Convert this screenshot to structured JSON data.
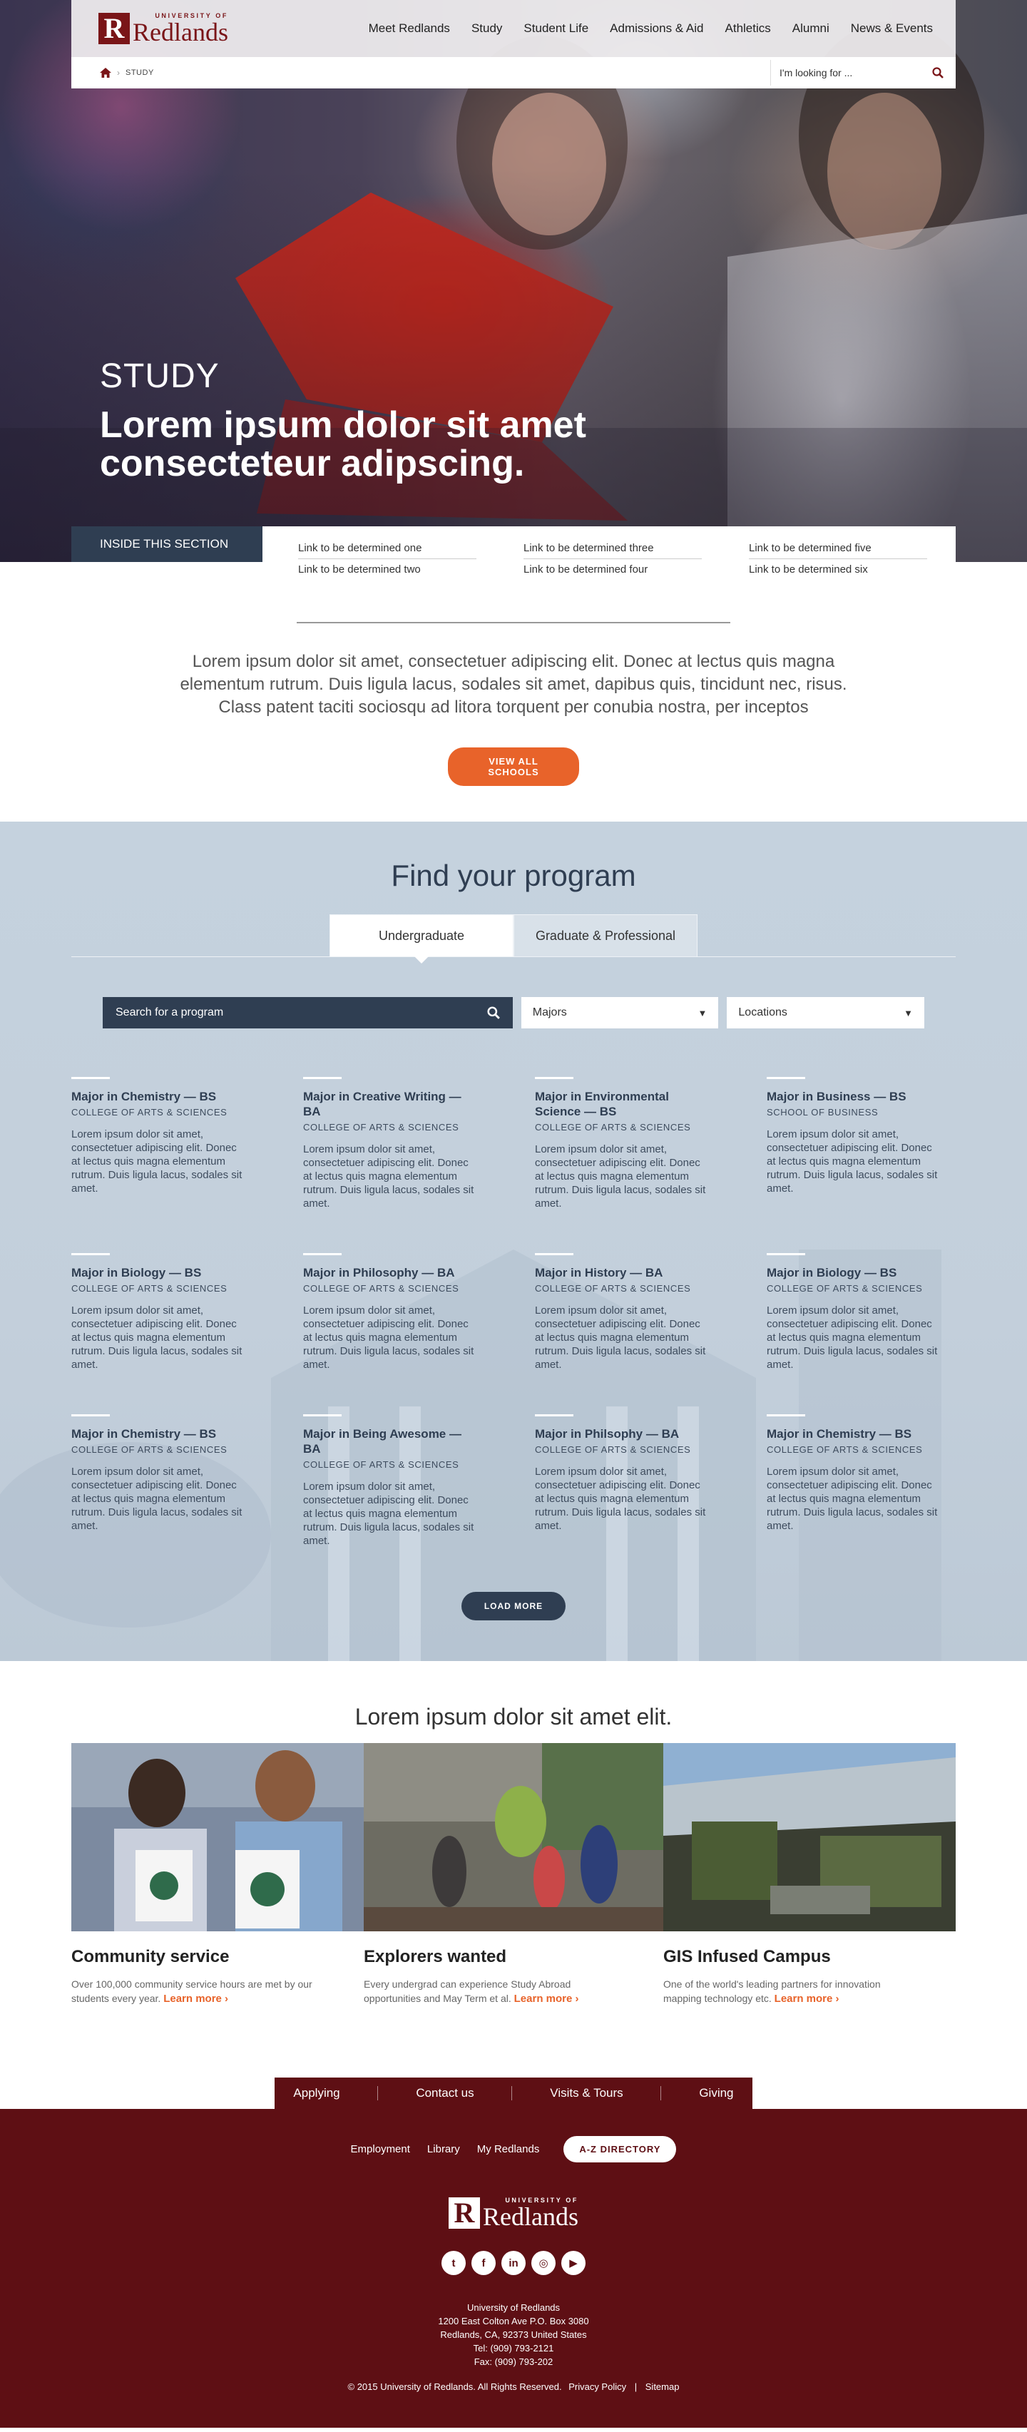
{
  "header": {
    "logo_small": "UNIVERSITY OF",
    "logo_big": "Redlands",
    "logo_mark": "R",
    "nav": [
      "Meet Redlands",
      "Study",
      "Student Life",
      "Admissions & Aid",
      "Athletics",
      "Alumni",
      "News & Events"
    ]
  },
  "breadcrumb": {
    "current": "STUDY",
    "home_icon": "home-icon",
    "separator": "›"
  },
  "search": {
    "placeholder": "I'm looking for ...",
    "icon": "search-icon"
  },
  "hero": {
    "eyebrow": "STUDY",
    "headline": "Lorem ipsum dolor sit amet consecteteur adipscing."
  },
  "inside_section": {
    "label": "INSIDE THIS SECTION",
    "links": [
      "Link to be determined one",
      "Link to be determined three",
      "Link to be determined five",
      "Link to be determined two",
      "Link to be determined four",
      "Link to be determined six"
    ]
  },
  "intro": {
    "text": "Lorem ipsum dolor sit amet, consectetuer adipiscing elit. Donec at lectus quis magna elementum rutrum. Duis ligula lacus, sodales sit amet, dapibus quis, tincidunt nec, risus. Class patent taciti sociosqu ad litora torquent per conubia nostra, per inceptos",
    "button": "VIEW ALL SCHOOLS"
  },
  "program_finder": {
    "title": "Find your program",
    "tabs": [
      "Undergraduate",
      "Graduate & Professional"
    ],
    "search_placeholder": "Search for a program",
    "majors_select": "Majors",
    "locations_select": "Locations",
    "load_more": "LOAD MORE",
    "programs": [
      {
        "title": "Major in Chemistry — BS",
        "school": "COLLEGE OF ARTS & SCIENCES",
        "desc": "Lorem ipsum dolor sit amet, consectetuer adipiscing elit. Donec at lectus quis magna elementum rutrum. Duis ligula lacus, sodales sit amet."
      },
      {
        "title": "Major in Creative Writing — BA",
        "school": "COLLEGE OF ARTS & SCIENCES",
        "desc": "Lorem ipsum dolor sit amet, consectetuer adipiscing elit. Donec at lectus quis magna elementum rutrum. Duis ligula lacus, sodales sit amet."
      },
      {
        "title": "Major in Environmental Science — BS",
        "school": "COLLEGE OF ARTS & SCIENCES",
        "desc": "Lorem ipsum dolor sit amet, consectetuer adipiscing elit. Donec at lectus quis magna elementum rutrum. Duis ligula lacus, sodales sit amet."
      },
      {
        "title": "Major in Business — BS",
        "school": "SCHOOL OF BUSINESS",
        "desc": "Lorem ipsum dolor sit amet, consectetuer adipiscing elit. Donec at lectus quis magna elementum rutrum. Duis ligula lacus, sodales sit amet."
      },
      {
        "title": "Major in Biology — BS",
        "school": "COLLEGE OF ARTS & SCIENCES",
        "desc": "Lorem ipsum dolor sit amet, consectetuer adipiscing elit. Donec at lectus quis magna elementum rutrum. Duis ligula lacus, sodales sit amet."
      },
      {
        "title": "Major in Philosophy — BA",
        "school": "COLLEGE OF ARTS & SCIENCES",
        "desc": "Lorem ipsum dolor sit amet, consectetuer adipiscing elit. Donec at lectus quis magna elementum rutrum. Duis ligula lacus, sodales sit amet."
      },
      {
        "title": "Major in History — BA",
        "school": "COLLEGE OF ARTS & SCIENCES",
        "desc": "Lorem ipsum dolor sit amet, consectetuer adipiscing elit. Donec at lectus quis magna elementum rutrum. Duis ligula lacus, sodales sit amet."
      },
      {
        "title": "Major in Biology — BS",
        "school": "COLLEGE OF ARTS & SCIENCES",
        "desc": "Lorem ipsum dolor sit amet, consectetuer adipiscing elit. Donec at lectus quis magna elementum rutrum. Duis ligula lacus, sodales sit amet."
      },
      {
        "title": "Major in Chemistry — BS",
        "school": "COLLEGE OF ARTS & SCIENCES",
        "desc": "Lorem ipsum dolor sit amet, consectetuer adipiscing elit. Donec at lectus quis magna elementum rutrum. Duis ligula lacus, sodales sit amet."
      },
      {
        "title": "Major in Being Awesome — BA",
        "school": "COLLEGE OF ARTS & SCIENCES",
        "desc": "Lorem ipsum dolor sit amet, consectetuer adipiscing elit. Donec at lectus quis magna elementum rutrum. Duis ligula lacus, sodales sit amet."
      },
      {
        "title": "Major in Philsophy — BA",
        "school": "COLLEGE OF ARTS & SCIENCES",
        "desc": "Lorem ipsum dolor sit amet, consectetuer adipiscing elit. Donec at lectus quis magna elementum rutrum. Duis ligula lacus, sodales sit amet."
      },
      {
        "title": "Major in Chemistry — BS",
        "school": "COLLEGE OF ARTS & SCIENCES",
        "desc": "Lorem ipsum dolor sit amet, consectetuer adipiscing elit. Donec at lectus quis magna elementum rutrum. Duis ligula lacus, sodales sit amet."
      }
    ]
  },
  "features": {
    "title": "Lorem ipsum dolor sit amet elit.",
    "items": [
      {
        "title": "Community service",
        "text": "Over 100,000 community service hours are met by our students every year.",
        "link": "Learn more ›"
      },
      {
        "title": "Explorers wanted",
        "text": "Every undergrad can experience Study Abroad opportunities and May Term et al.",
        "link": "Learn more ›"
      },
      {
        "title": "GIS Infused Campus",
        "text": "One of the world's leading partners for innovation mapping technology etc.",
        "link": "Learn more ›"
      }
    ]
  },
  "footer": {
    "tabs": [
      "Applying",
      "Contact us",
      "Visits & Tours",
      "Giving"
    ],
    "links": [
      "Employment",
      "Library",
      "My Redlands"
    ],
    "az_button": "A-Z DIRECTORY",
    "social_icons": [
      "twitter-icon",
      "facebook-icon",
      "linkedin-icon",
      "instagram-icon",
      "youtube-icon"
    ],
    "social_glyphs": [
      "t",
      "f",
      "in",
      "◎",
      "▶"
    ],
    "address": [
      "University of Redlands",
      "1200 East Colton Ave P.O. Box 3080",
      "Redlands, CA, 92373 United States",
      "Tel: (909) 793-2121",
      "Fax: (909) 793-202"
    ],
    "copyright": "© 2015 University of Redlands. All Rights Reserved.",
    "privacy": "Privacy Policy",
    "sitemap": "Sitemap"
  },
  "colors": {
    "brand": "#7a1518",
    "footer": "#5e0f14",
    "navy": "#2f3e52",
    "accent": "#e8632a",
    "program_bg": "#c5d2de"
  }
}
